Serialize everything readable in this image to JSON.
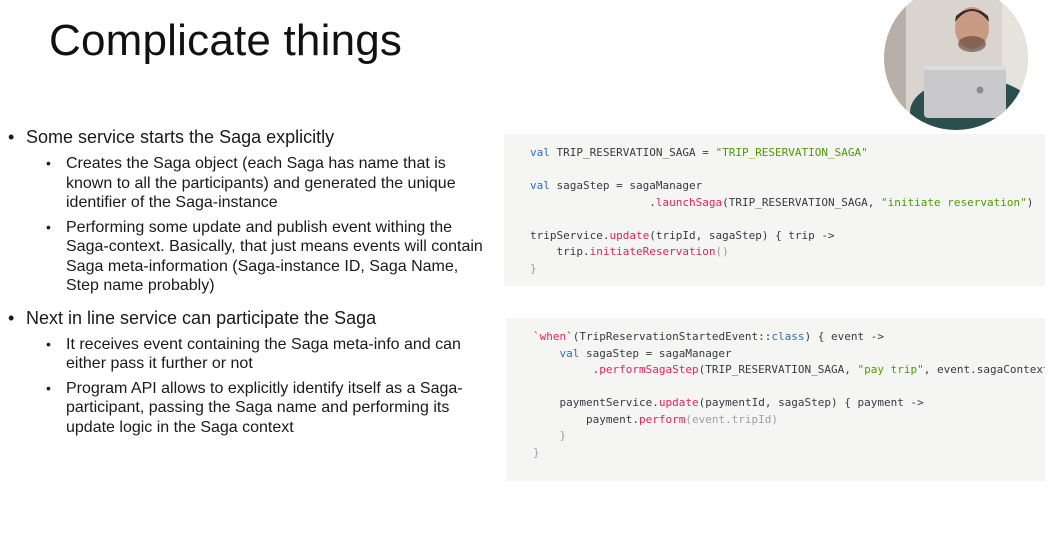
{
  "slide": {
    "title": "Complicate things"
  },
  "bullets": [
    {
      "text": "Some service starts the Saga explicitly",
      "children": [
        "Creates the Saga object (each Saga has name that is known to all the participants) and generated the unique identifier of the Saga-instance",
        "Performing some update and publish event withing the Saga-context. Basically, that just means events will contain Saga meta-information (Saga-instance ID, Saga Name, Step name probably)"
      ]
    },
    {
      "text": "Next in line service can participate the Saga",
      "children": [
        "It receives event containing the Saga meta-info and can either pass it further or not",
        "Program API allows to explicitly identify itself as a Saga-participant, passing the Saga name and performing its update logic in the Saga context"
      ]
    }
  ],
  "code_block_1": {
    "l1_kw": "val",
    "l1_rest": " TRIP_RESERVATION_SAGA = ",
    "l1_str": "\"TRIP_RESERVATION_SAGA\"",
    "l3_kw": "val",
    "l3_rest": " sagaStep = sagaManager",
    "l4_indent": "                  .",
    "l4_fn": "launchSaga",
    "l4_rest": "(TRIP_RESERVATION_SAGA, ",
    "l4_str": "\"initiate reservation\"",
    "l4_close": ")",
    "l6_a": "tripService.",
    "l6_fn": "update",
    "l6_b": "(tripId, sagaStep) { trip ->",
    "l7_a": "    trip.",
    "l7_fn": "initiateReservation",
    "l7_b": "()",
    "l8": "}"
  },
  "code_block_2": {
    "l1_a": "`",
    "l1_kw": "when",
    "l1_b": "`(TripReservationStartedEvent::",
    "l1_kw2": "class",
    "l1_c": ") { event ->",
    "l2_kw": "    val",
    "l2_rest": " sagaStep = sagaManager",
    "l3_indent": "         .",
    "l3_fn": "performSagaStep",
    "l3_a": "(TRIP_RESERVATION_SAGA, ",
    "l3_str": "\"pay trip\"",
    "l3_b": ", event.sagaContext)",
    "l5_a": "    paymentService.",
    "l5_fn": "update",
    "l5_b": "(paymentId, sagaStep) { payment ->",
    "l6_a": "        payment.",
    "l6_fn": "perform",
    "l6_b": "(event.tripId)",
    "l7": "    }",
    "l8": "}"
  },
  "colors": {
    "keyword": "#2c6fc0",
    "string": "#4f9a06",
    "function": "#e0245e",
    "code_bg": "#f5f5f4"
  }
}
